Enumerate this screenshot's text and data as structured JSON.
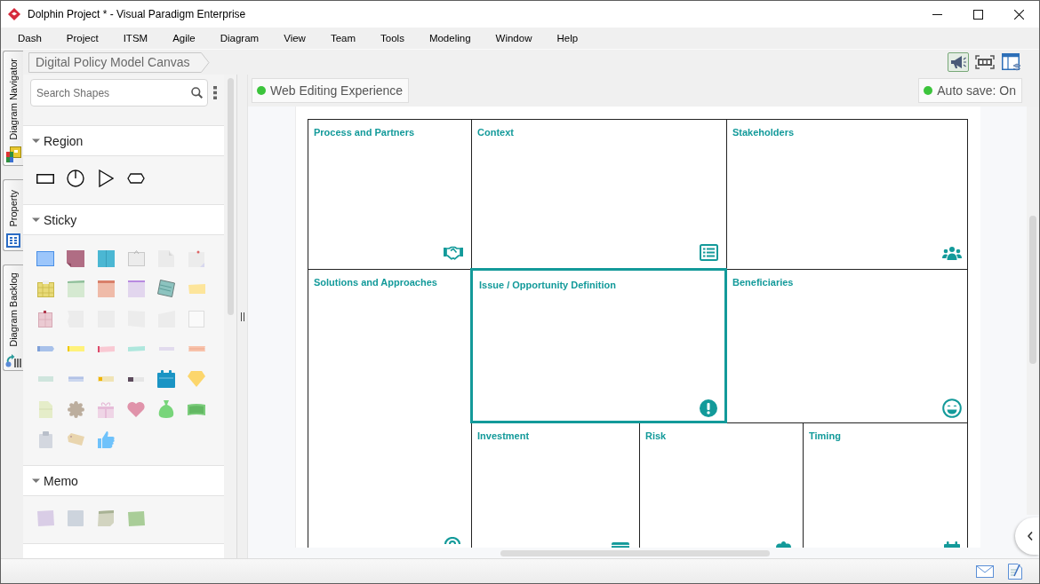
{
  "window": {
    "title": "Dolphin Project * - Visual Paradigm Enterprise"
  },
  "menu": [
    "Dash",
    "Project",
    "ITSM",
    "Agile",
    "Diagram",
    "View",
    "Team",
    "Tools",
    "Modeling",
    "Window",
    "Help"
  ],
  "side_tabs": [
    {
      "label": "Diagram Navigator"
    },
    {
      "label": "Property"
    },
    {
      "label": "Diagram Backlog"
    }
  ],
  "breadcrumb": {
    "label": "Digital Policy Model Canvas"
  },
  "toolbar": [
    {
      "on": true
    },
    {
      "on": false
    },
    {
      "on": false
    }
  ],
  "palette": {
    "search": {
      "placeholder": "Search Shapes"
    },
    "sections": [
      {
        "title": "Region",
        "expanded": true
      },
      {
        "title": "Sticky",
        "expanded": true
      },
      {
        "title": "Memo",
        "expanded": true
      }
    ]
  },
  "canvas": {
    "web_editing": {
      "label": "Web Editing Experience",
      "on": true
    },
    "auto_save": {
      "label": "Auto save: On",
      "on": true
    },
    "cells": [
      {
        "title": "Process and Partners",
        "highlighted": false
      },
      {
        "title": "Context",
        "highlighted": false
      },
      {
        "title": "Stakeholders",
        "highlighted": false
      },
      {
        "title": "Solutions and Approaches",
        "highlighted": false
      },
      {
        "title": "Issue / Opportunity Definition",
        "highlighted": true
      },
      {
        "title": "Beneficiaries",
        "highlighted": false
      },
      {
        "title": "Investment",
        "highlighted": false
      },
      {
        "title": "Risk",
        "highlighted": false
      },
      {
        "title": "Timing",
        "highlighted": false
      }
    ]
  }
}
